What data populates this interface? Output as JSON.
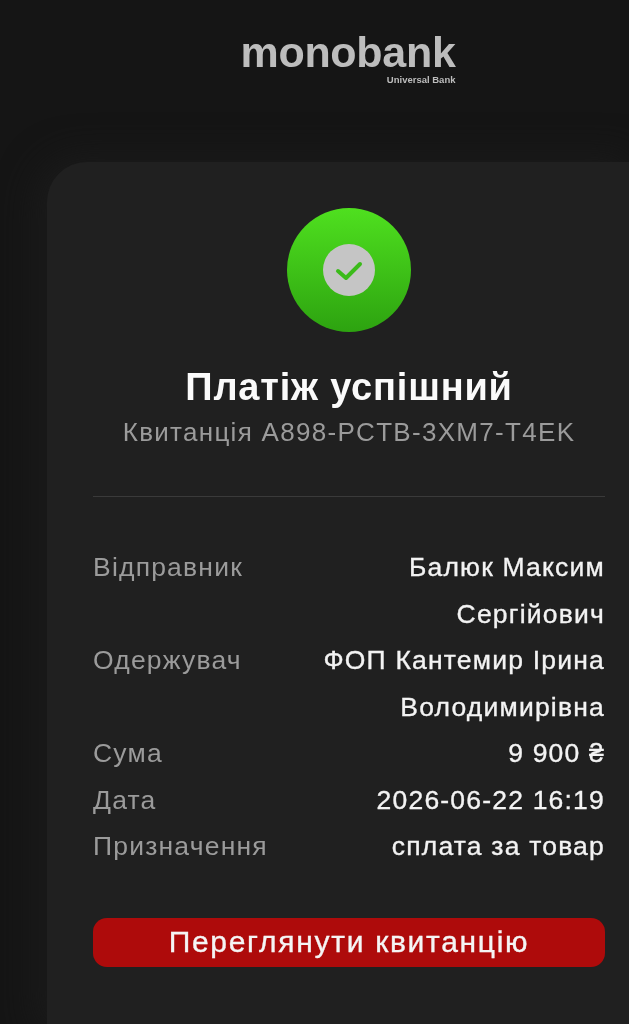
{
  "header": {
    "logo": "monobank",
    "tagline": "Universal Bank"
  },
  "receipt": {
    "success": true,
    "title": "Платіж успішний",
    "subtitle": "Квитанція A898-PCTB-3XM7-T4EK",
    "details": [
      {
        "label": "Відправник",
        "value": "Балюк Максим Сергійович"
      },
      {
        "label": "Одержувач",
        "value": "ФОП Кантемир Ірина Володимирівна"
      },
      {
        "label": "Сума",
        "value": "9 900 ₴"
      },
      {
        "label": "Дата",
        "value": "2026-06-22 16:19"
      },
      {
        "label": "Призначення",
        "value": "сплата за товар"
      }
    ],
    "button": "Переглянути квитанцію"
  }
}
